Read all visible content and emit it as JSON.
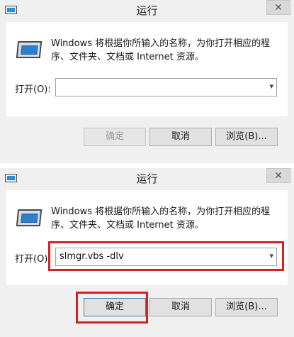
{
  "dialogs": [
    {
      "title": "运行",
      "close_glyph": "✕",
      "description": "Windows 将根据你所输入的名称，为你打开相应的程序、文件夹、文档或 Internet 资源。",
      "open_label": "打开(O):",
      "input_value": "",
      "buttons": {
        "ok": "确定",
        "cancel": "取消",
        "browse": "浏览(B)..."
      }
    },
    {
      "title": "运行",
      "close_glyph": "✕",
      "description": "Windows 将根据你所输入的名称，为你打开相应的程序、文件夹、文档或 Internet 资源。",
      "open_label": "打开(O):",
      "input_value": "slmgr.vbs -dlv",
      "buttons": {
        "ok": "确定",
        "cancel": "取消",
        "browse": "浏览(B)..."
      }
    }
  ],
  "colors": {
    "highlight": "#d81f26",
    "dialog_bg": "#f0f0f0",
    "client_bg": "#ffffff"
  },
  "icons": {
    "window": "run-window-icon",
    "run": "run-program-icon",
    "dropdown": "chevron-down-icon"
  }
}
